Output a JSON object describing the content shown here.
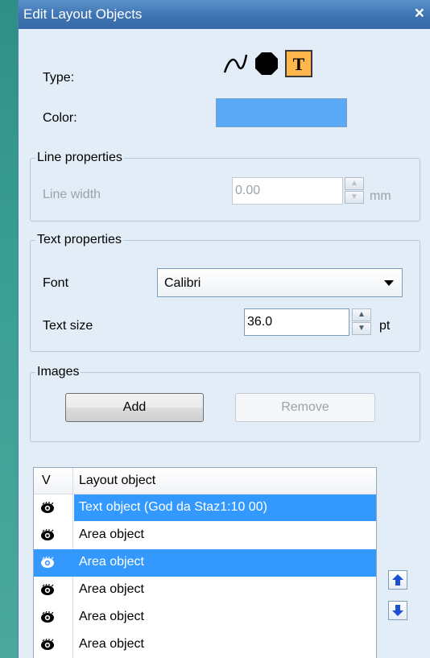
{
  "window": {
    "title": "Edit Layout Objects",
    "close_glyph": "×"
  },
  "type": {
    "label": "Type:",
    "icons": [
      {
        "name": "line-tool-icon",
        "active": false
      },
      {
        "name": "area-tool-icon",
        "active": false
      },
      {
        "name": "text-tool-icon",
        "active": true
      }
    ]
  },
  "color": {
    "label": "Color:",
    "value": "#5aa9f6"
  },
  "line_properties": {
    "legend": "Line properties",
    "width_label": "Line width",
    "width_value": "0.00",
    "unit": "mm",
    "enabled": false
  },
  "text_properties": {
    "legend": "Text properties",
    "font_label": "Font",
    "font_value": "Calibri",
    "size_label": "Text size",
    "size_value": "36.0",
    "size_unit": "pt"
  },
  "images": {
    "legend": "Images",
    "add_label": "Add",
    "remove_label": "Remove"
  },
  "objects_table": {
    "col_v": "V",
    "col_name": "Layout object",
    "rows": [
      {
        "name": "Text object (God da Staz1:10 00)",
        "selected": "text"
      },
      {
        "name": "Area object",
        "selected": "none"
      },
      {
        "name": "Area object",
        "selected": "all"
      },
      {
        "name": "Area object",
        "selected": "none"
      },
      {
        "name": "Area object",
        "selected": "none"
      },
      {
        "name": "Area object",
        "selected": "none"
      }
    ]
  },
  "move_buttons": {
    "up": "arrow-up-icon",
    "down": "arrow-down-icon"
  }
}
